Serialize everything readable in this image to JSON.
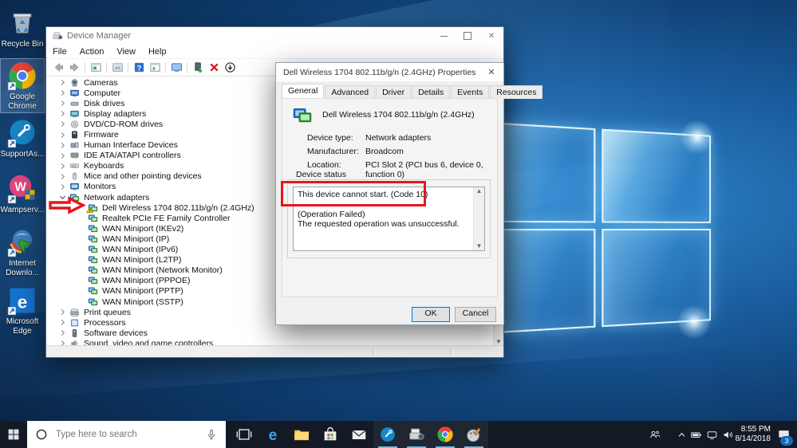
{
  "desktop": {
    "icons": [
      {
        "name": "recycle-bin",
        "label": "Recycle Bin",
        "selected": false
      },
      {
        "name": "google-chrome",
        "label": "Google Chrome",
        "selected": true
      },
      {
        "name": "supportassist",
        "label": "SupportAs...",
        "selected": false
      },
      {
        "name": "wampserver",
        "label": "Wampserv...",
        "selected": false
      },
      {
        "name": "internet-download-manager",
        "label": "Internet Downlo...",
        "selected": false
      },
      {
        "name": "microsoft-edge",
        "label": "Microsoft Edge",
        "selected": false
      }
    ]
  },
  "device_manager": {
    "title": "Device Manager",
    "menu": [
      "File",
      "Action",
      "View",
      "Help"
    ],
    "toolbar": [
      "back",
      "forward",
      "|",
      "console-window",
      "|",
      "export-list",
      "|",
      "help",
      "show-items",
      "|",
      "computer",
      "|",
      "update-driver",
      "uninstall-device",
      "scan-hardware"
    ],
    "tree": [
      {
        "label": "Cameras",
        "icon": "camera",
        "level": 0,
        "state": "collapsed"
      },
      {
        "label": "Computer",
        "icon": "computer",
        "level": 0,
        "state": "collapsed"
      },
      {
        "label": "Disk drives",
        "icon": "disk",
        "level": 0,
        "state": "collapsed"
      },
      {
        "label": "Display adapters",
        "icon": "display",
        "level": 0,
        "state": "collapsed"
      },
      {
        "label": "DVD/CD-ROM drives",
        "icon": "dvd",
        "level": 0,
        "state": "collapsed"
      },
      {
        "label": "Firmware",
        "icon": "firmware",
        "level": 0,
        "state": "collapsed"
      },
      {
        "label": "Human Interface Devices",
        "icon": "hid",
        "level": 0,
        "state": "collapsed"
      },
      {
        "label": "IDE ATA/ATAPI controllers",
        "icon": "ide",
        "level": 0,
        "state": "collapsed"
      },
      {
        "label": "Keyboards",
        "icon": "keyboard",
        "level": 0,
        "state": "collapsed"
      },
      {
        "label": "Mice and other pointing devices",
        "icon": "mouse",
        "level": 0,
        "state": "collapsed"
      },
      {
        "label": "Monitors",
        "icon": "monitor",
        "level": 0,
        "state": "collapsed"
      },
      {
        "label": "Network adapters",
        "icon": "network",
        "level": 0,
        "state": "expanded"
      },
      {
        "label": "Dell Wireless 1704 802.11b/g/n (2.4GHz)",
        "icon": "network",
        "level": 1,
        "warning": true
      },
      {
        "label": "Realtek PCIe FE Family Controller",
        "icon": "network",
        "level": 1
      },
      {
        "label": "WAN Miniport (IKEv2)",
        "icon": "network",
        "level": 1
      },
      {
        "label": "WAN Miniport (IP)",
        "icon": "network",
        "level": 1
      },
      {
        "label": "WAN Miniport (IPv6)",
        "icon": "network",
        "level": 1
      },
      {
        "label": "WAN Miniport (L2TP)",
        "icon": "network",
        "level": 1
      },
      {
        "label": "WAN Miniport (Network Monitor)",
        "icon": "network",
        "level": 1
      },
      {
        "label": "WAN Miniport (PPPOE)",
        "icon": "network",
        "level": 1
      },
      {
        "label": "WAN Miniport (PPTP)",
        "icon": "network",
        "level": 1
      },
      {
        "label": "WAN Miniport (SSTP)",
        "icon": "network",
        "level": 1
      },
      {
        "label": "Print queues",
        "icon": "printer",
        "level": 0,
        "state": "collapsed"
      },
      {
        "label": "Processors",
        "icon": "processor",
        "level": 0,
        "state": "collapsed"
      },
      {
        "label": "Software devices",
        "icon": "software",
        "level": 0,
        "state": "collapsed"
      },
      {
        "label": "Sound, video and game controllers",
        "icon": "sound",
        "level": 0,
        "state": "collapsed"
      }
    ]
  },
  "dialog": {
    "title": "Dell Wireless 1704 802.11b/g/n (2.4GHz) Properties",
    "tabs": [
      {
        "label": "General",
        "active": true
      },
      {
        "label": "Advanced",
        "active": false
      },
      {
        "label": "Driver",
        "active": false
      },
      {
        "label": "Details",
        "active": false
      },
      {
        "label": "Events",
        "active": false
      },
      {
        "label": "Resources",
        "active": false
      }
    ],
    "device_name": "Dell Wireless 1704 802.11b/g/n (2.4GHz)",
    "fields": [
      {
        "label": "Device type:",
        "value": "Network adapters"
      },
      {
        "label": "Manufacturer:",
        "value": "Broadcom"
      },
      {
        "label": "Location:",
        "value": "PCI Slot 2 (PCI bus 6, device 0, function 0)"
      }
    ],
    "status_group_label": "Device status",
    "status_lines": [
      "This device cannot start. (Code 10)",
      "",
      "(Operation Failed)",
      "The requested operation was unsuccessful."
    ],
    "ok_label": "OK",
    "cancel_label": "Cancel"
  },
  "annotations": {
    "highlight_color": "#e8151d",
    "arrow_target": "Dell Wireless 1704 802.11b/g/n (2.4GHz)",
    "box_target": "This device cannot start. (Code 10)"
  },
  "taskbar": {
    "search_placeholder": "Type here to search",
    "apps": [
      {
        "name": "task-view",
        "active": false
      },
      {
        "name": "edge",
        "active": false
      },
      {
        "name": "file-explorer",
        "active": false
      },
      {
        "name": "store",
        "active": false
      },
      {
        "name": "mail",
        "active": false
      },
      {
        "name": "supportassist",
        "active": true
      },
      {
        "name": "device-manager",
        "active": true
      },
      {
        "name": "chrome",
        "active": true
      },
      {
        "name": "paint",
        "active": true
      }
    ],
    "tray_icons": [
      "people",
      "chevron-up",
      "battery",
      "network",
      "volume"
    ],
    "time": "8:55 PM",
    "date": "8/14/2018",
    "notification_count": "3"
  }
}
